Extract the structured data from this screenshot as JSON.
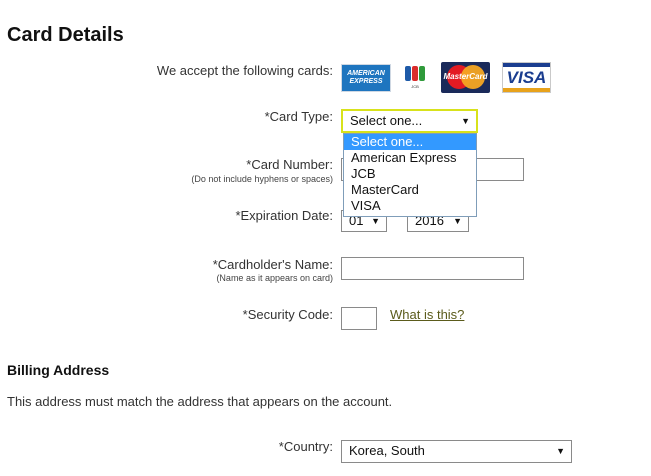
{
  "card_details": {
    "title": "Card Details",
    "accept_label": "We accept the following cards:",
    "cards": {
      "amex_line1": "AMERICAN",
      "amex_line2": "EXPRESS",
      "jcb": "JCB",
      "mastercard": "MasterCard",
      "visa": "VISA"
    },
    "card_type_label": "*Card Type:",
    "card_type_value": "Select one...",
    "card_type_options": [
      "Select one...",
      "American Express",
      "JCB",
      "MasterCard",
      "VISA"
    ],
    "card_number_label": "*Card Number:",
    "card_number_hint": "(Do not include hyphens or spaces)",
    "expiration_label": "*Expiration Date:",
    "expiration_month": "01",
    "expiration_year": "2016",
    "cardholder_label": "*Cardholder's Name:",
    "cardholder_hint": "(Name as it appears on card)",
    "security_label": "*Security Code:",
    "security_help_link": "What is this?"
  },
  "billing": {
    "title": "Billing Address",
    "description": "This address must match the address that appears on the account.",
    "country_label": "*Country:",
    "country_value": "Korea, South"
  },
  "colors": {
    "focus_border": "#d8e21b",
    "selected_option": "#3399ff",
    "link": "#5b5b1b"
  }
}
